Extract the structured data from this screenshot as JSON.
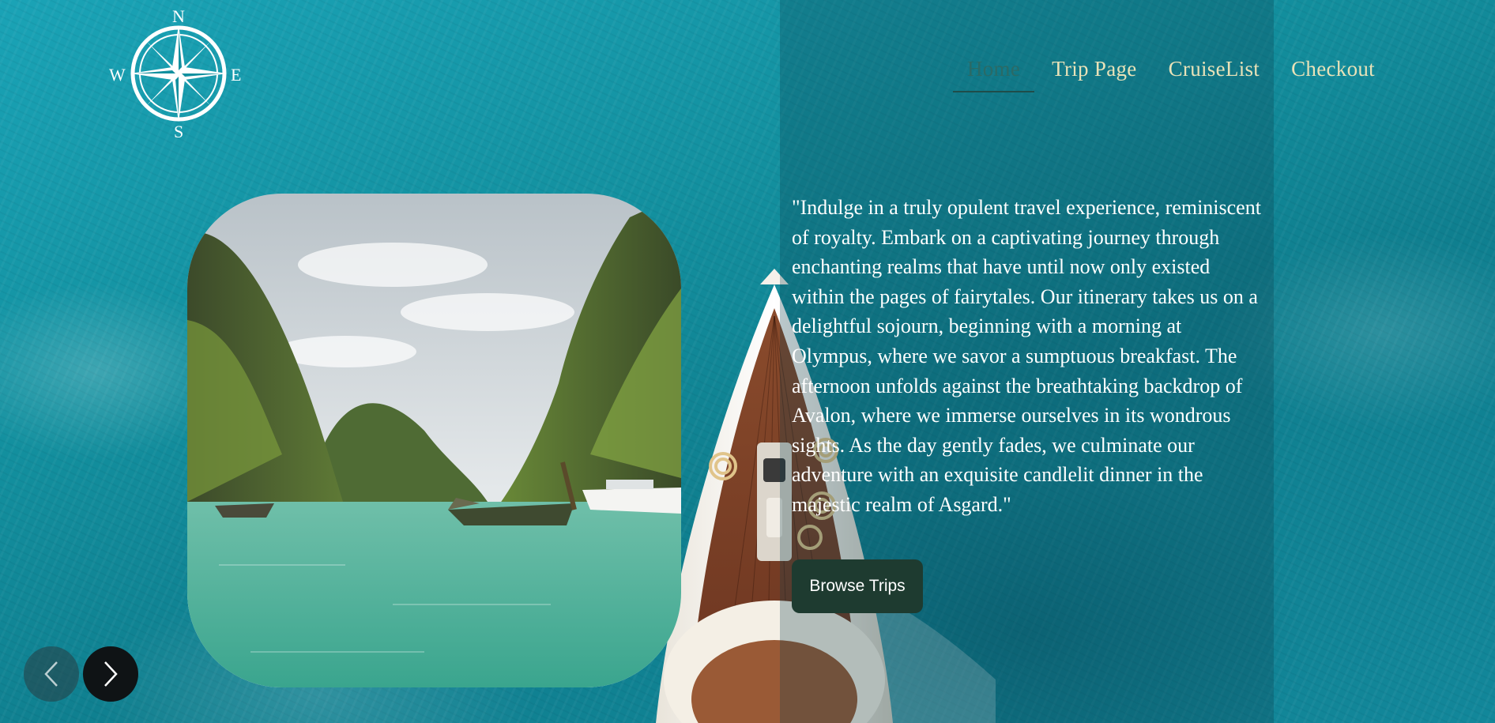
{
  "brand": {
    "compass_letters": {
      "north": "N",
      "south": "S",
      "east": "E",
      "west": "W"
    },
    "logo_icon": "compass-rose-icon"
  },
  "nav": {
    "items": [
      {
        "label": "Home",
        "active": true
      },
      {
        "label": "Trip Page",
        "active": false
      },
      {
        "label": "CruiseList",
        "active": false
      },
      {
        "label": "Checkout",
        "active": false
      }
    ]
  },
  "hero": {
    "quote": "\"Indulge in a truly opulent travel experience, reminiscent of royalty. Embark on a captivating journey through enchanting realms that have until now only existed within the pages of fairytales. Our itinerary takes us on a delightful sojourn, beginning with a morning at Olympus, where we savor a sumptuous breakfast. The afternoon unfolds against the breathtaking backdrop of Avalon, where we immerse ourselves in its wondrous sights. As the day gently fades, we culminate our adventure with an exquisite candlelit dinner in the majestic realm of Asgard.\"",
    "cta_label": "Browse Trips"
  },
  "carousel": {
    "prev_icon": "chevron-left-icon",
    "next_icon": "chevron-right-icon"
  },
  "colors": {
    "ocean": "#13909f",
    "nav_text": "#e9e2b8",
    "nav_active": "#2a6a66",
    "button_bg": "#1e3b30",
    "quote_text": "#ffffff"
  }
}
